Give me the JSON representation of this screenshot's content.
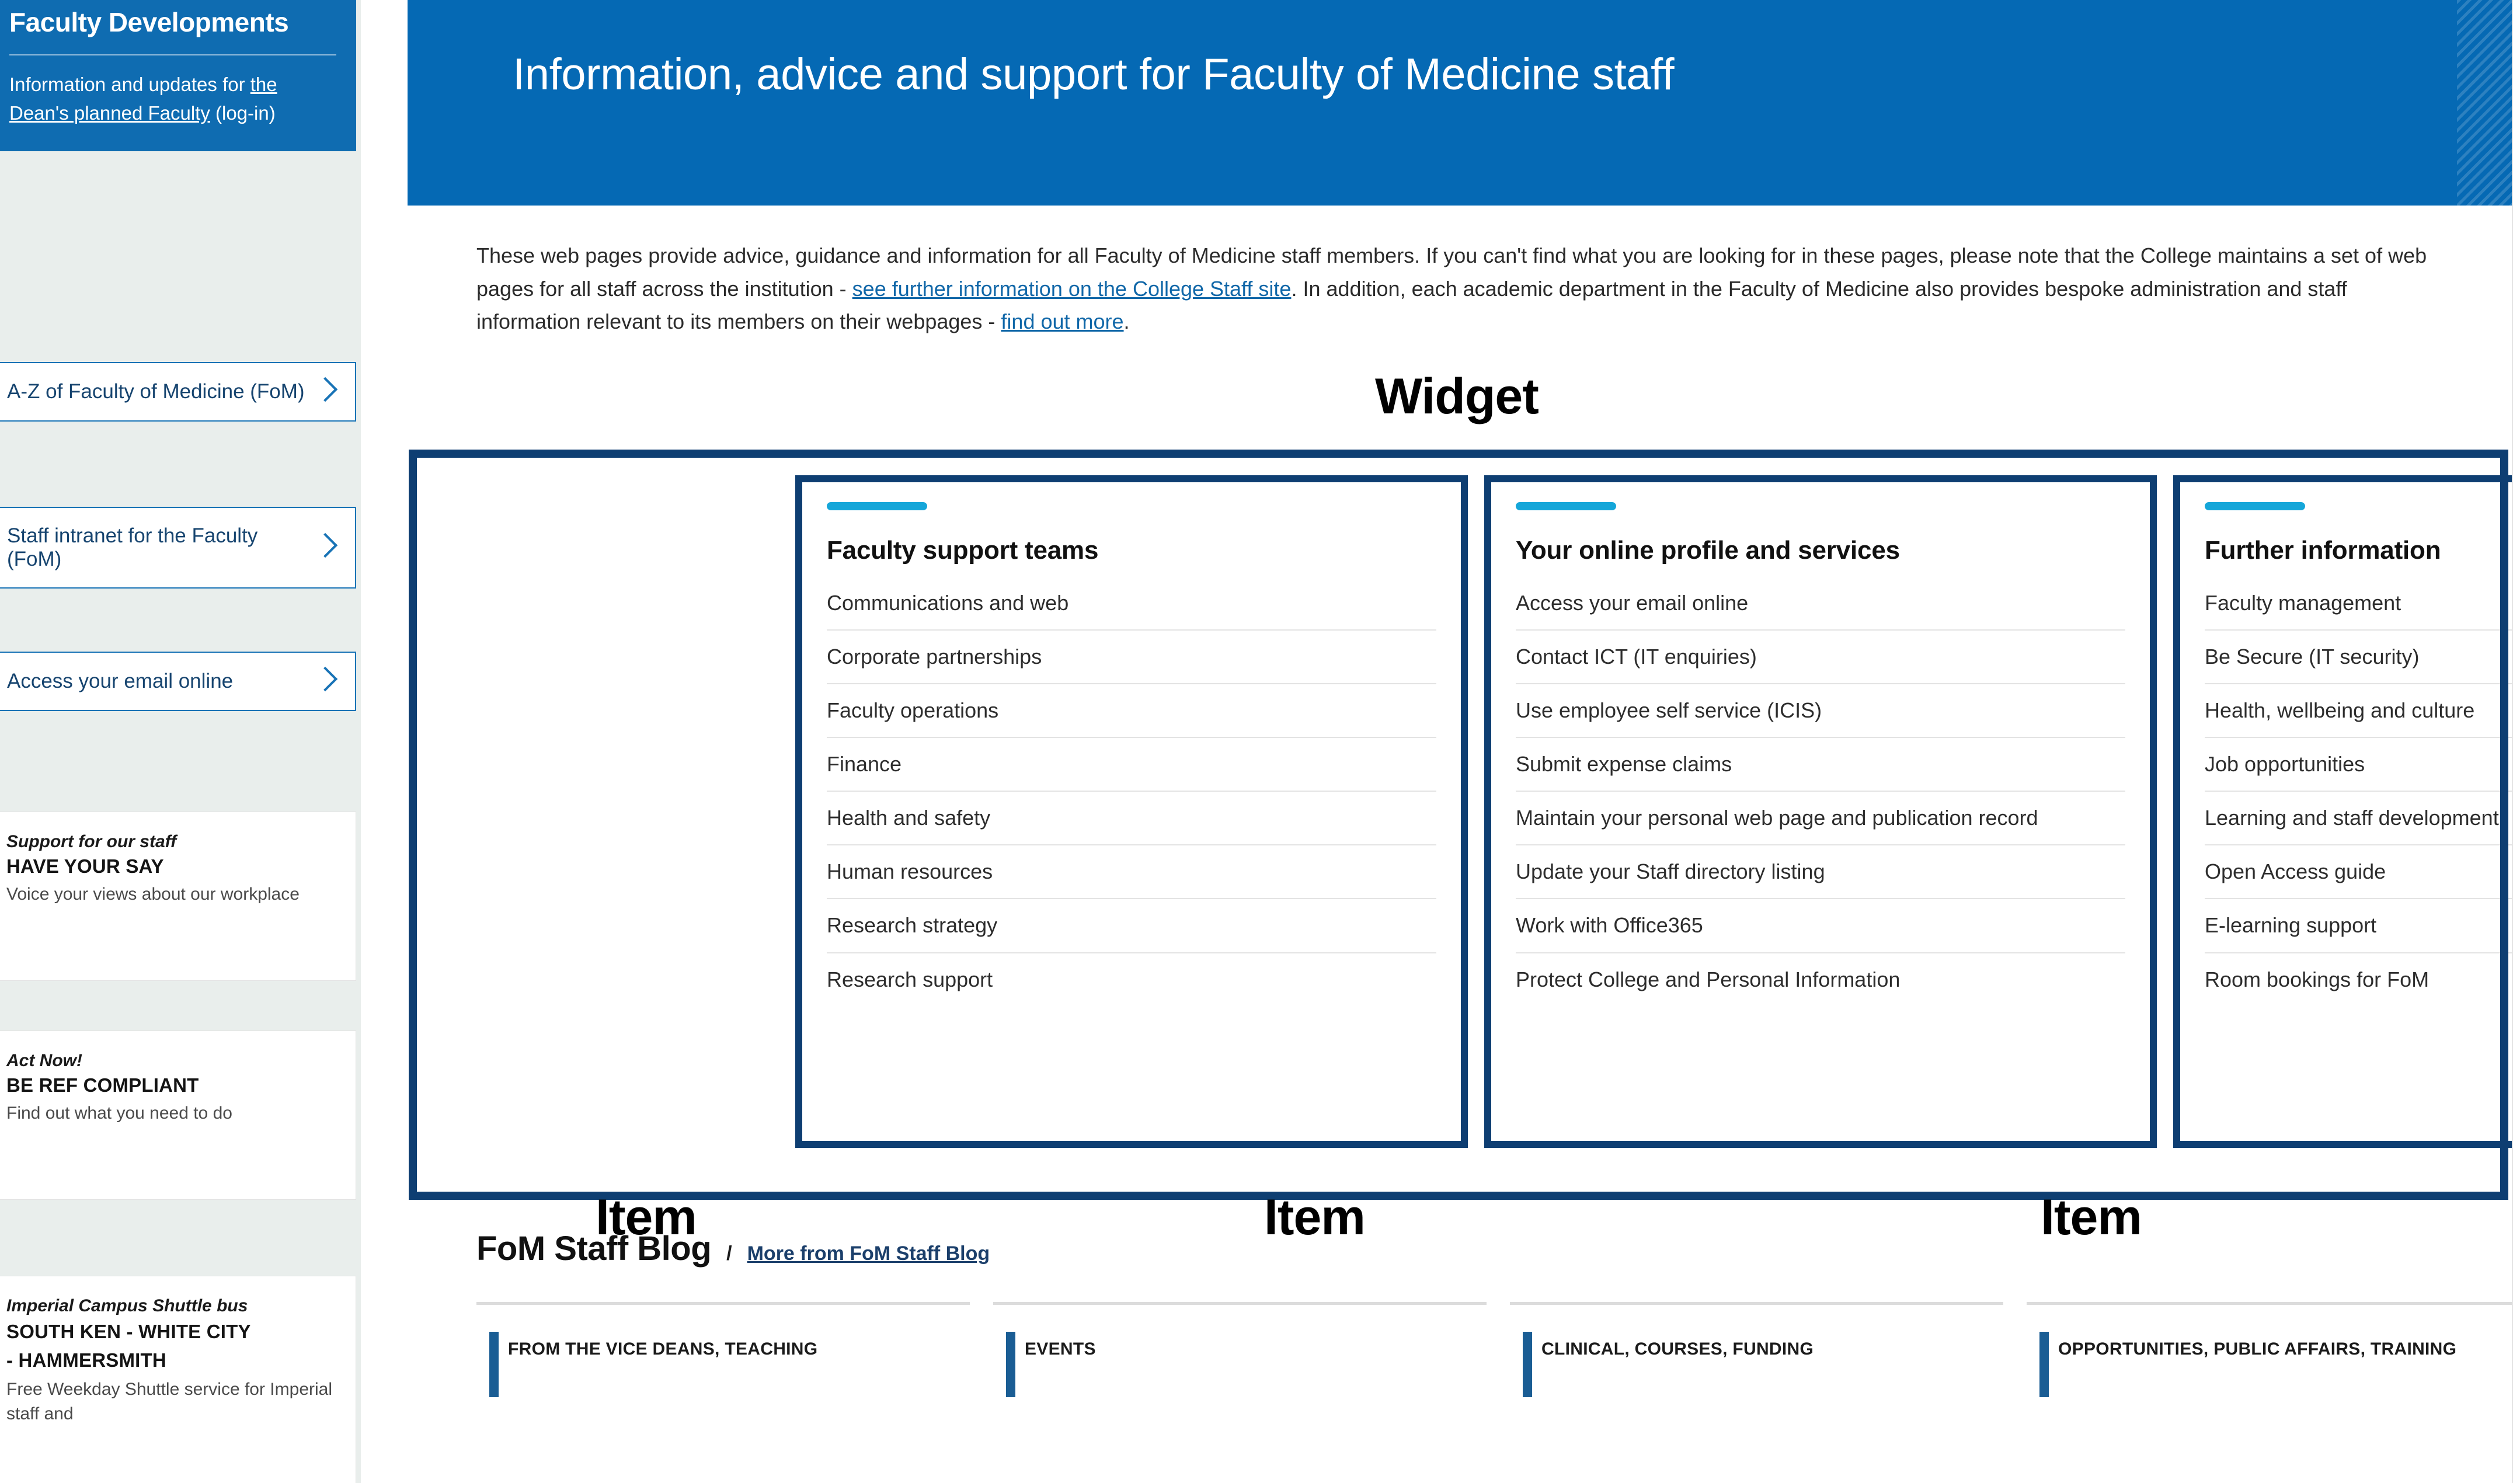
{
  "sidebar": {
    "promo_blue": {
      "heading": "Faculty Developments",
      "body_pre": "Information and updates for ",
      "link": "the Dean's planned Faculty",
      "body_post": " (log-in)"
    },
    "nav_cards": [
      {
        "label": "A-Z of Faculty of Medicine (FoM)"
      },
      {
        "label": "Staff intranet for the Faculty (FoM)"
      },
      {
        "label": "Access your email online"
      }
    ],
    "promos": [
      {
        "kicker": "Support for our staff",
        "title": "HAVE YOUR SAY",
        "body": "Voice your views about our workplace"
      },
      {
        "kicker": "Act Now!",
        "title": "BE REF COMPLIANT",
        "body": "Find out what you need to do"
      },
      {
        "kicker": "Imperial Campus Shuttle bus",
        "title_line1": "SOUTH KEN - WHITE CITY",
        "title_line2": "- HAMMERSMITH",
        "body": "Free Weekday Shuttle service for Imperial staff and"
      }
    ]
  },
  "hero": {
    "title": "Information, advice and support for Faculty of Medicine staff",
    "background_color": "#0569b4"
  },
  "intro": {
    "p1": "These web pages provide advice, guidance and information for all Faculty of Medicine staff members. If you can't find what you are looking for in these pages, please note that the College maintains a set of web pages for all staff across the institution - ",
    "link1": "see further information on the College Staff site",
    "p2": ". In addition, each academic department in the Faculty of Medicine also provides bespoke administration and staff information relevant to its members on their webpages - ",
    "link2": "find out more",
    "p3": "."
  },
  "annotations": {
    "widget": "Widget",
    "item": "Item",
    "outline_color": "#0e3e72"
  },
  "widget": {
    "accent_color": "#15a6d9",
    "columns": [
      {
        "title": "Faculty support teams",
        "items": [
          "Communications and web",
          "Corporate partnerships",
          "Faculty operations",
          "Finance",
          "Health and safety",
          "Human resources",
          "Research strategy",
          "Research support"
        ]
      },
      {
        "title": "Your online profile and services",
        "items": [
          "Access your email online",
          "Contact ICT (IT enquiries)",
          "Use employee self service (ICIS)",
          "Submit expense claims",
          "Maintain your personal web page and publication record",
          "Update your Staff directory listing",
          "Work with Office365",
          "Protect College and Personal Information"
        ]
      },
      {
        "title": "Further information",
        "items": [
          "Faculty management",
          "Be Secure (IT security)",
          "Health, wellbeing and culture",
          "Job opportunities",
          "Learning and staff development",
          "Open Access guide",
          "E-learning support",
          "Room bookings for FoM"
        ]
      }
    ]
  },
  "blog": {
    "title": "FoM Staff Blog",
    "separator": "/",
    "more_label": "More from FoM Staff Blog",
    "cards": [
      {
        "category": "FROM THE VICE DEANS, TEACHING"
      },
      {
        "category": "EVENTS"
      },
      {
        "category": "CLINICAL, COURSES, FUNDING"
      },
      {
        "category": "OPPORTUNITIES, PUBLIC AFFAIRS, TRAINING"
      }
    ]
  }
}
